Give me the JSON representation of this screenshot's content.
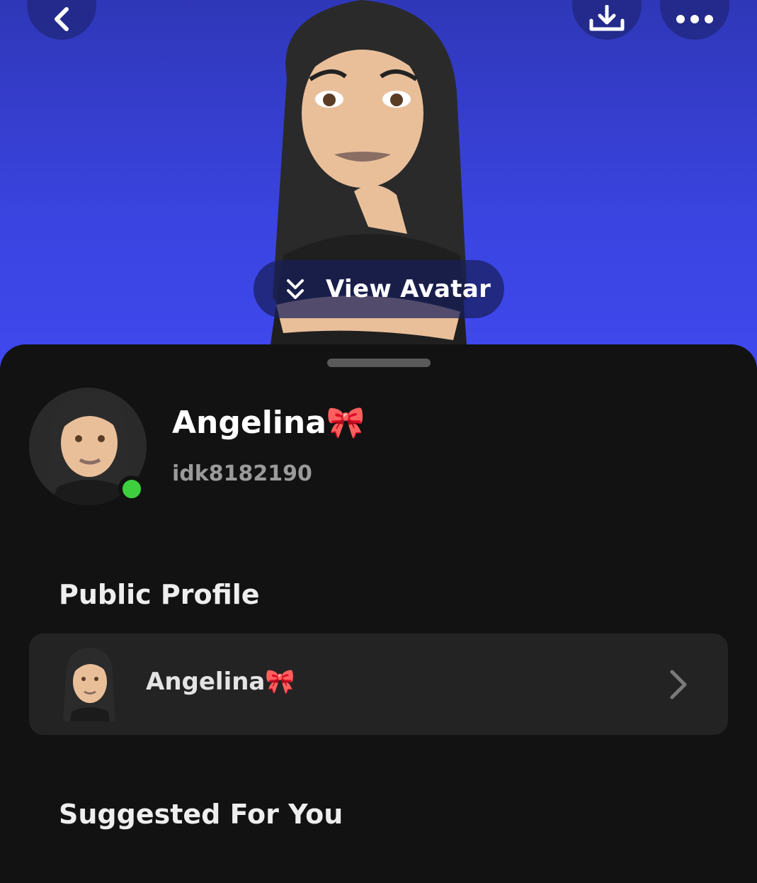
{
  "header": {
    "back_icon": "chevron-left-icon",
    "share_icon": "download-icon",
    "more_icon": "ellipsis-icon",
    "view_avatar_icon": "double-chevron-down-icon",
    "view_avatar_label": "View Avatar",
    "gradient_colors": [
      "#2f37b8",
      "#3f49ee"
    ]
  },
  "profile": {
    "display_name": "Angelina🎀",
    "username": "idk8182190",
    "online": true,
    "online_color": "#3ecf3e"
  },
  "public_profile": {
    "title": "Public Profile",
    "card_name": "Angelina🎀",
    "chevron_icon": "chevron-right-icon"
  },
  "suggested": {
    "title": "Suggested For You"
  }
}
